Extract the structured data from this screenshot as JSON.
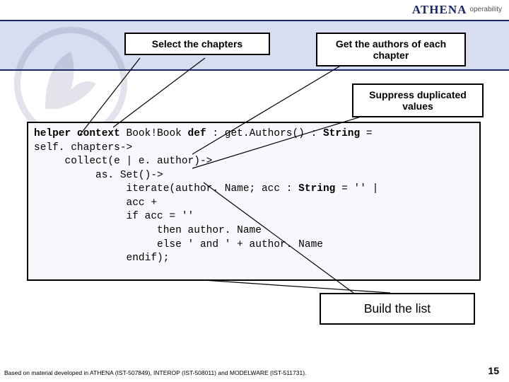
{
  "header": {
    "brand": "ATHENA",
    "tag": "operability"
  },
  "callouts": {
    "selectChapters": "Select the chapters",
    "getAuthors": "Get the authors of each chapter",
    "suppress": "Suppress duplicated values",
    "buildList": "Build the list"
  },
  "code": {
    "l1a": "helper context",
    "l1b": " Book!Book ",
    "l1c": "def",
    "l1d": " : get.Authors() : ",
    "l1e": "String",
    "l1f": " =",
    "l2": "self. chapters->",
    "l3": "     collect(e | e. author)->",
    "l4": "          as. Set()->",
    "l5a": "               iterate(author. Name; acc : ",
    "l5b": "String",
    "l5c": " = '' |",
    "l6": "               acc +",
    "l7": "               if acc = ''",
    "l8": "                    then author. Name",
    "l9": "                    else ' and ' + author. Name",
    "l10": "               endif);"
  },
  "footer": {
    "credit": "Based on material developed in ATHENA (IST-507849), INTEROP (IST-508011) and MODELWARE (IST-511731).",
    "page": "15"
  }
}
